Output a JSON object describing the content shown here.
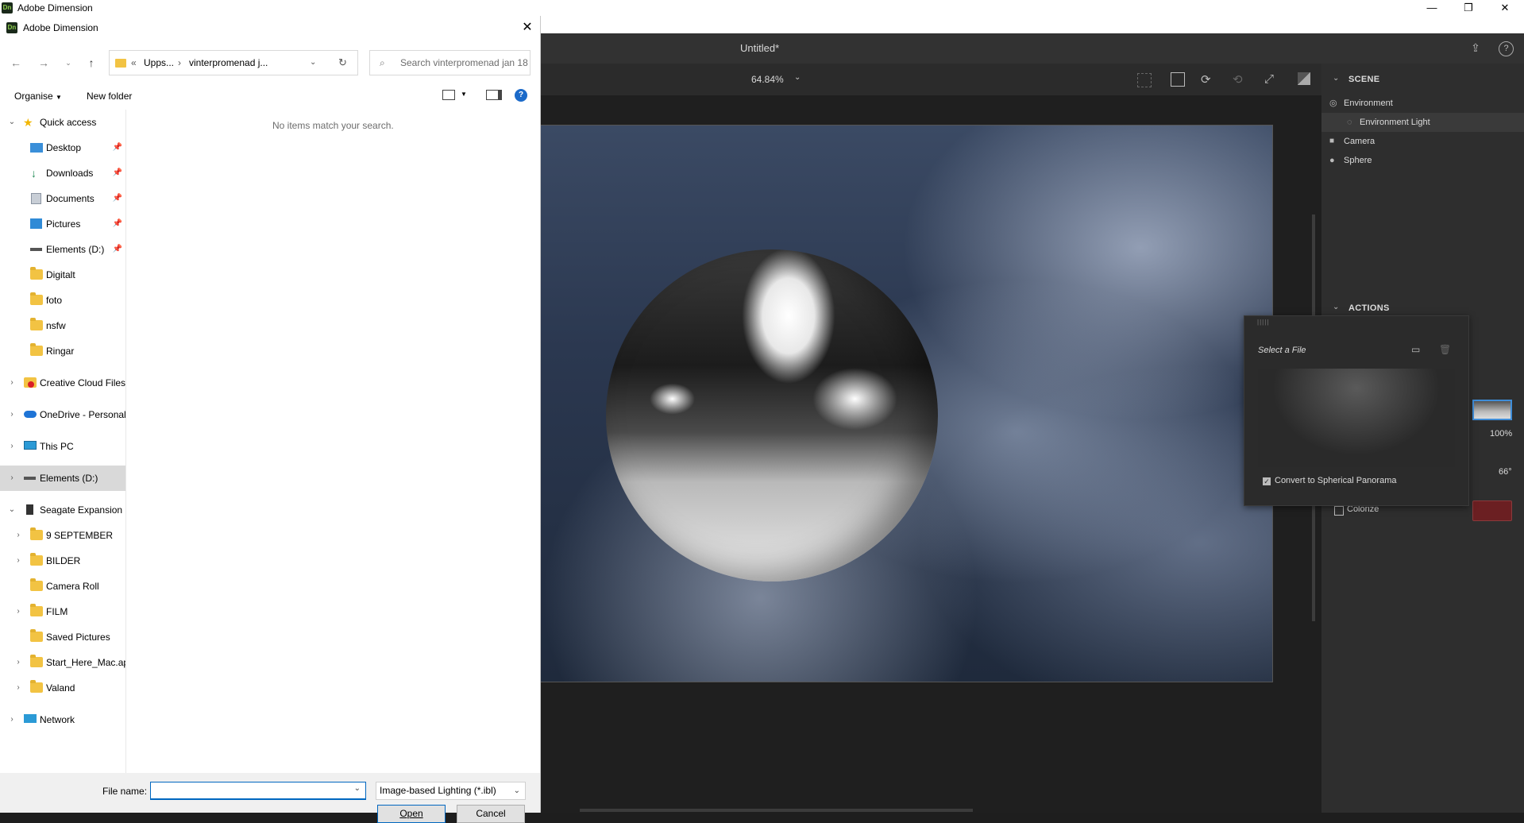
{
  "app": {
    "title": "Adobe Dimension",
    "badge": "Dn",
    "document_title": "Untitled*",
    "zoom": "64.84%"
  },
  "scene_panel": {
    "header": "SCENE",
    "items": [
      {
        "label": "Environment"
      },
      {
        "label": "Environment Light"
      },
      {
        "label": "Camera"
      },
      {
        "label": "Sphere"
      }
    ],
    "actions_header": "ACTIONS",
    "intensity": "100%",
    "rotation": "66°",
    "colorize_label": "Colorize",
    "colorize_color": "#6b1f22"
  },
  "select_file_popup": {
    "title": "Select a File",
    "convert_label": "Convert to Spherical Panorama",
    "convert_checked": true
  },
  "file_dialog": {
    "title": "Adobe Dimension",
    "breadcrumb": [
      "Upps...",
      "vinterpromenad j..."
    ],
    "breadcrumb_prefix": "«",
    "search_placeholder": "Search vinterpromenad jan 18",
    "organise_label": "Organise",
    "new_folder_label": "New folder",
    "empty_message": "No items match your search.",
    "nav_items": [
      {
        "label": "Quick access",
        "icon": "star-icon"
      },
      {
        "label": "Desktop",
        "icon": "desktop-icon",
        "pinned": true
      },
      {
        "label": "Downloads",
        "icon": "download-icon",
        "pinned": true
      },
      {
        "label": "Documents",
        "icon": "documents-icon",
        "pinned": true
      },
      {
        "label": "Pictures",
        "icon": "pictures-icon",
        "pinned": true
      },
      {
        "label": "Elements (D:)",
        "icon": "drive-icon",
        "pinned": true
      },
      {
        "label": "Digitalt",
        "icon": "folder-icon"
      },
      {
        "label": "foto",
        "icon": "folder-icon"
      },
      {
        "label": "nsfw",
        "icon": "folder-icon"
      },
      {
        "label": "Ringar",
        "icon": "folder-icon"
      },
      {
        "label": "Creative Cloud Files",
        "icon": "creative-cloud-icon"
      },
      {
        "label": "OneDrive - Personal",
        "icon": "onedrive-icon"
      },
      {
        "label": "This PC",
        "icon": "computer-icon"
      },
      {
        "label": "Elements (D:)",
        "icon": "drive-icon"
      },
      {
        "label": "Seagate Expansion D",
        "icon": "drive-icon"
      },
      {
        "label": "9 SEPTEMBER",
        "icon": "folder-icon"
      },
      {
        "label": "BILDER",
        "icon": "folder-icon"
      },
      {
        "label": "Camera Roll",
        "icon": "folder-icon"
      },
      {
        "label": "FILM",
        "icon": "folder-icon"
      },
      {
        "label": "Saved Pictures",
        "icon": "folder-icon"
      },
      {
        "label": "Start_Here_Mac.ap",
        "icon": "folder-icon"
      },
      {
        "label": "Valand",
        "icon": "folder-icon"
      },
      {
        "label": "Network",
        "icon": "network-icon"
      }
    ],
    "file_name_label": "File name:",
    "file_name_value": "",
    "file_type": "Image-based Lighting (*.ibl)",
    "open_label": "Open",
    "cancel_label": "Cancel"
  }
}
